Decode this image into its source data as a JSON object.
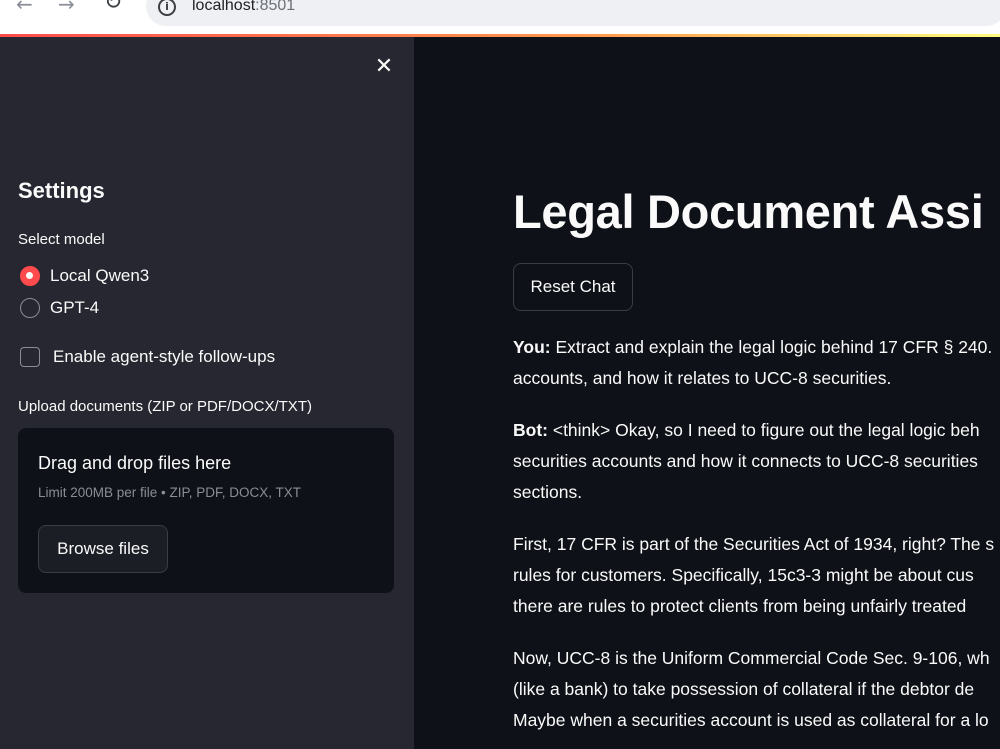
{
  "browser": {
    "url_host": "localhost",
    "url_port": ":8501"
  },
  "sidebar": {
    "close_symbol": "✕",
    "settings_title": "Settings",
    "select_model_label": "Select model",
    "models": [
      {
        "label": "Local Qwen3",
        "selected": true
      },
      {
        "label": "GPT-4",
        "selected": false
      }
    ],
    "agent_followups_label": "Enable agent-style follow-ups",
    "agent_followups_checked": false,
    "upload_label": "Upload documents (ZIP or PDF/DOCX/TXT)",
    "dropzone_title": "Drag and drop files here",
    "dropzone_limit": "Limit 200MB per file • ZIP, PDF, DOCX, TXT",
    "browse_label": "Browse files"
  },
  "main": {
    "title": "Legal Document Assi",
    "reset_label": "Reset Chat",
    "messages": [
      {
        "speaker": "You:",
        "lines": [
          " Extract and explain the legal logic behind 17 CFR § 240.",
          "accounts, and how it relates to UCC-8 securities."
        ]
      },
      {
        "speaker": "Bot:",
        "lines": [
          " <think> Okay, so I need to figure out the legal logic beh",
          "securities accounts and how it connects to UCC-8 securities",
          "sections."
        ]
      },
      {
        "speaker": "",
        "lines": [
          "First, 17 CFR is part of the Securities Act of 1934, right? The s",
          "rules for customers. Specifically, 15c3-3 might be about cus",
          "there are rules to protect clients from being unfairly treated"
        ]
      },
      {
        "speaker": "",
        "lines": [
          "Now, UCC-8 is the Uniform Commercial Code Sec. 9-106, wh",
          "(like a bank) to take possession of collateral if the debtor de",
          "Maybe when a securities account is used as collateral for a lo"
        ]
      }
    ]
  },
  "colors": {
    "accent": "#ff4b4b",
    "sidebar_bg": "#262730",
    "main_bg": "#0e1117"
  }
}
